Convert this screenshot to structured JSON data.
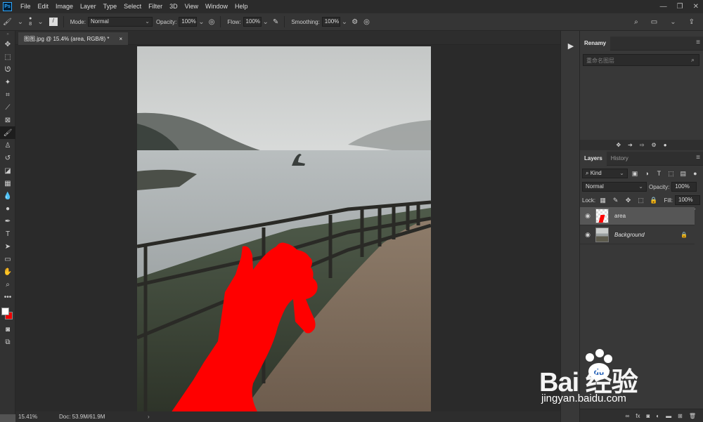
{
  "menubar": {
    "logo": "Ps",
    "items": [
      "File",
      "Edit",
      "Image",
      "Layer",
      "Type",
      "Select",
      "Filter",
      "3D",
      "View",
      "Window",
      "Help"
    ]
  },
  "options": {
    "brush_size": "8",
    "mode_label": "Mode:",
    "mode_value": "Normal",
    "opacity_label": "Opacity:",
    "opacity_value": "100%",
    "flow_label": "Flow:",
    "flow_value": "100%",
    "smoothing_label": "Smoothing:",
    "smoothing_value": "100%"
  },
  "document": {
    "tab_title": "图图.jpg @ 15.4% (area, RGB/8) *",
    "tab_close": "×"
  },
  "status": {
    "zoom": "15.41%",
    "doc_size": "Doc: 53.9M/61.9M",
    "arrow": "›"
  },
  "renamy": {
    "title": "Renamy",
    "search_placeholder": "重命名图层"
  },
  "layers_panel": {
    "tabs": [
      "Layers",
      "History"
    ],
    "kind_filter": "Kind",
    "blend_mode": "Normal",
    "opacity_label": "Opacity:",
    "opacity_value": "100%",
    "lock_label": "Lock:",
    "fill_label": "Fill:",
    "fill_value": "100%",
    "layers": [
      {
        "name": "area",
        "selected": true
      },
      {
        "name": "Background",
        "selected": false,
        "locked": true
      }
    ]
  },
  "colors": {
    "foreground": "#ffffff",
    "background": "#e60000",
    "paint": "#ff0000"
  },
  "watermark": {
    "brand": "Bai  经验",
    "url": "jingyan.baidu.com"
  },
  "icons": {
    "tools": [
      "move-icon",
      "marquee-icon",
      "lasso-icon",
      "magic-wand-icon",
      "crop-icon",
      "eyedropper-icon",
      "frame-icon",
      "brush-icon",
      "stamp-icon",
      "history-brush-icon",
      "eraser-icon",
      "gradient-icon",
      "blur-icon",
      "dodge-icon",
      "pen-icon",
      "type-icon",
      "path-select-icon",
      "rectangle-icon",
      "hand-icon",
      "zoom-icon",
      "more-icon"
    ]
  }
}
